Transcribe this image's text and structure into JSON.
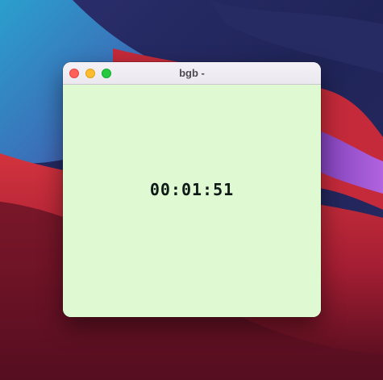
{
  "window": {
    "title": "bgb -"
  },
  "screen": {
    "timer": "00:01:51"
  },
  "colors": {
    "screen_bg": "#dff9d2",
    "timer_text": "#0e1a16",
    "close": "#fe5f57",
    "minimize": "#febc2e",
    "zoom": "#28c840"
  },
  "icons": {
    "close": "close-button",
    "minimize": "minimize-button",
    "zoom": "zoom-button"
  }
}
